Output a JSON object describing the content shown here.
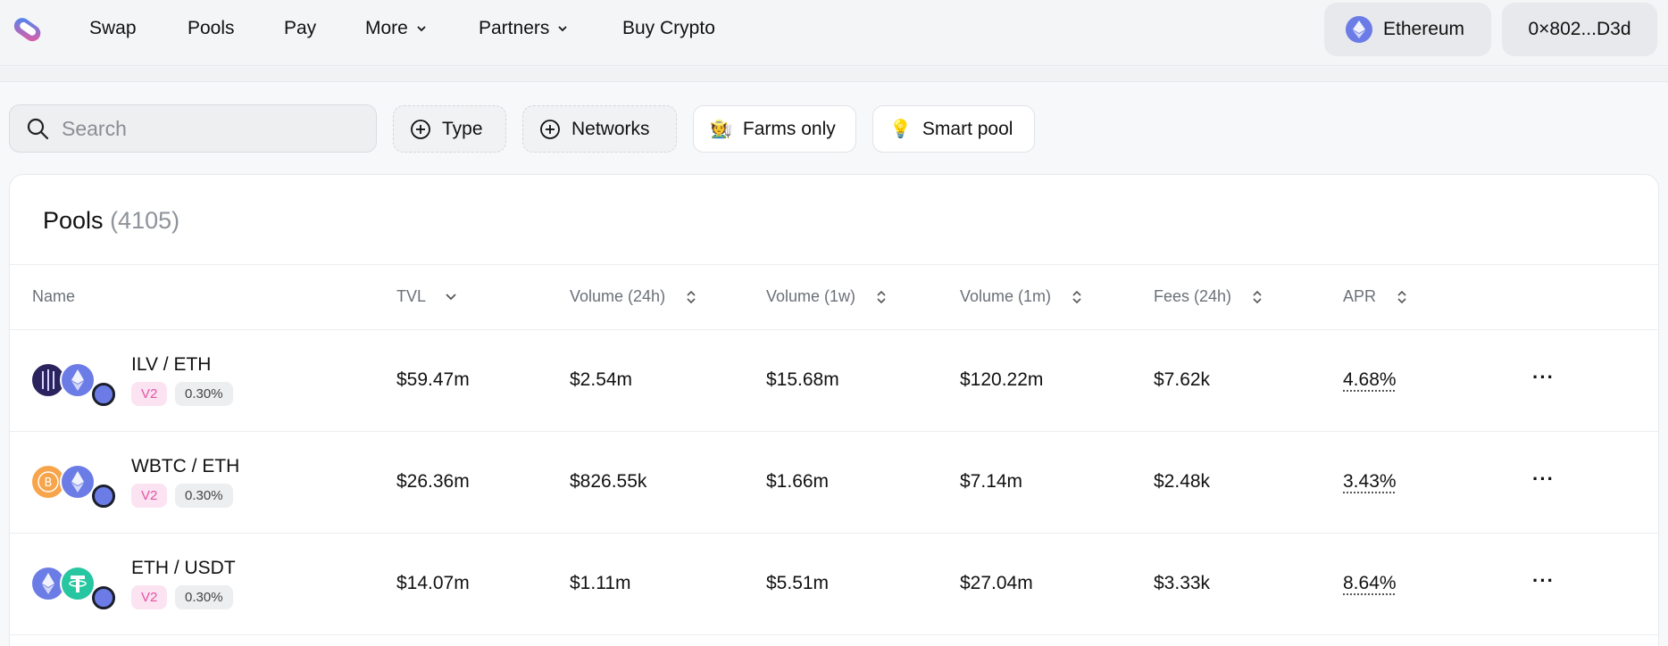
{
  "nav": {
    "items": [
      "Swap",
      "Pools",
      "Pay",
      "More",
      "Partners",
      "Buy Crypto"
    ],
    "network": "Ethereum",
    "wallet": "0×802...D3d"
  },
  "filters": {
    "search_placeholder": "Search",
    "type_label": "Type",
    "networks_label": "Networks",
    "farms_label": "Farms only",
    "farms_emoji": "🧑‍🌾",
    "smart_label": "Smart pool",
    "smart_emoji": "💡"
  },
  "pools": {
    "title": "Pools",
    "count": "(4105)",
    "columns": [
      "Name",
      "TVL",
      "Volume (24h)",
      "Volume (1w)",
      "Volume (1m)",
      "Fees (24h)",
      "APR"
    ],
    "rows": [
      {
        "pair": "ILV / ETH",
        "version": "V2",
        "fee": "0.30%",
        "tvl": "$59.47m",
        "vol24h": "$2.54m",
        "vol1w": "$15.68m",
        "vol1m": "$120.22m",
        "fees24h": "$7.62k",
        "apr": "4.68%",
        "more": "···"
      },
      {
        "pair": "WBTC / ETH",
        "version": "V2",
        "fee": "0.30%",
        "tvl": "$26.36m",
        "vol24h": "$826.55k",
        "vol1w": "$1.66m",
        "vol1m": "$7.14m",
        "fees24h": "$2.48k",
        "apr": "3.43%",
        "more": "···"
      },
      {
        "pair": "ETH / USDT",
        "version": "V2",
        "fee": "0.30%",
        "tvl": "$14.07m",
        "vol24h": "$1.11m",
        "vol1w": "$5.51m",
        "vol1m": "$27.04m",
        "fees24h": "$3.33k",
        "apr": "8.64%",
        "more": "···"
      }
    ]
  },
  "colors": {
    "eth": "#6b7ce6",
    "ilv": "#2b235e",
    "wbtc": "#f7a44a",
    "usdt": "#26c6a0",
    "v2_badge_bg": "#fbe3f1",
    "v2_badge_text": "#e354a5"
  }
}
